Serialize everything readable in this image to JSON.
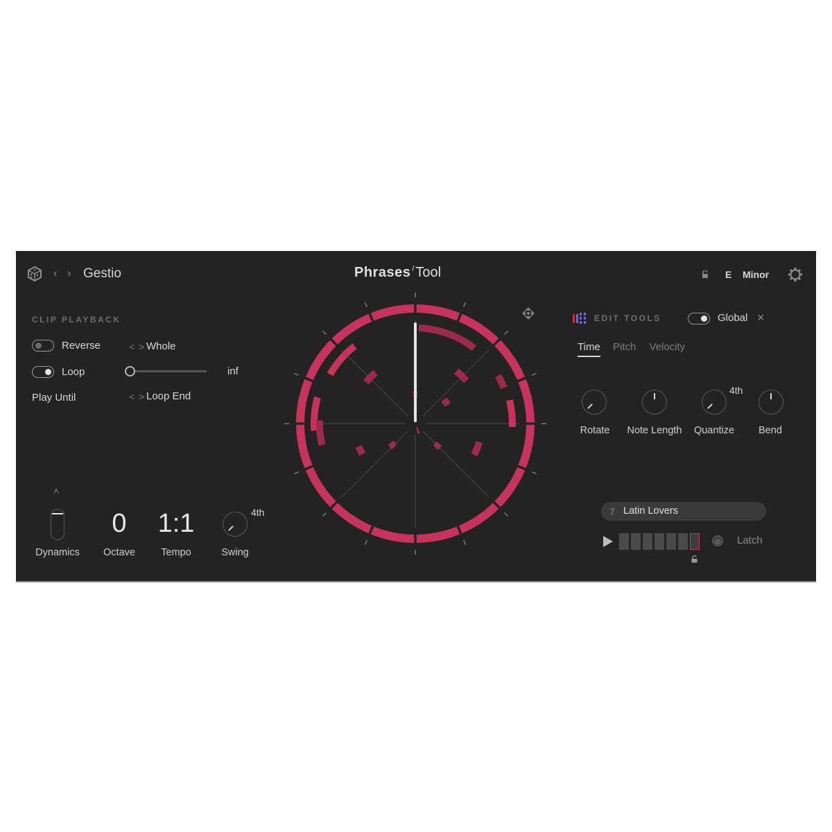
{
  "header": {
    "preset_name": "Gestio",
    "title_main": "Phrases",
    "title_slash": "/",
    "title_sub": "Tool",
    "key_root": "E",
    "key_scale": "Minor",
    "icons": {
      "dice": "dice-icon",
      "prev": "chevron-left-icon",
      "next": "chevron-right-icon",
      "lock": "lock-open-icon",
      "settings": "gear-icon"
    }
  },
  "clip_playback": {
    "section_title": "CLIP PLAYBACK",
    "reverse": {
      "label": "Reverse",
      "on": false,
      "mode_arrows": "< >",
      "mode_value": "Whole"
    },
    "loop": {
      "label": "Loop",
      "on": true,
      "slider_value": "inf",
      "slider_position": 0
    },
    "play_until": {
      "label": "Play Until",
      "mode_arrows": "< >",
      "value": "Loop End"
    }
  },
  "performance": {
    "dynamics": {
      "label": "Dynamics",
      "caret": "^"
    },
    "octave": {
      "label": "Octave",
      "value": "0"
    },
    "tempo": {
      "label": "Tempo",
      "value": "1:1"
    },
    "swing": {
      "label": "Swing",
      "value": "4th"
    }
  },
  "edit_tools": {
    "title": "EDIT TOOLS",
    "global_label": "Global",
    "global_on": true,
    "close": "×",
    "tabs": [
      {
        "label": "Time",
        "active": true
      },
      {
        "label": "Pitch",
        "active": false
      },
      {
        "label": "Velocity",
        "active": false
      }
    ],
    "knobs": [
      {
        "label": "Rotate",
        "value": ""
      },
      {
        "label": "Note Length",
        "value": ""
      },
      {
        "label": "Quantize",
        "value": "4th"
      },
      {
        "label": "Bend",
        "value": ""
      }
    ]
  },
  "phrase": {
    "number": "7",
    "name": "Latin Lovers",
    "latch_label": "Latch",
    "steps_total": 7,
    "active_step": 7
  },
  "colors": {
    "accent": "#c8325f",
    "accent_dim": "#9c2a4c",
    "panel": "#232323",
    "text": "#d8d8d8"
  }
}
